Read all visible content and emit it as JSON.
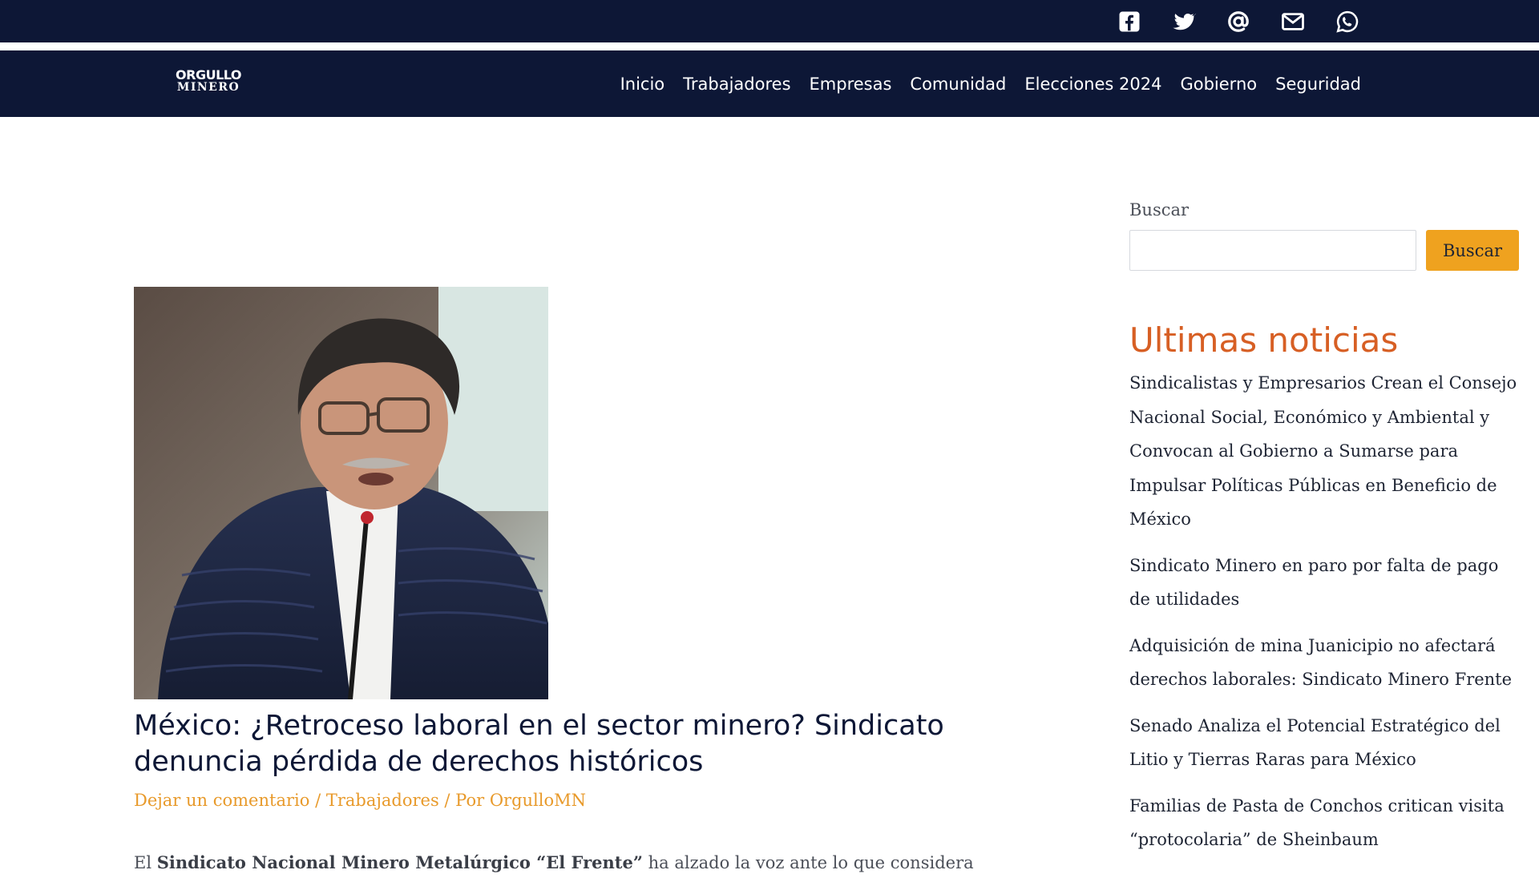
{
  "social": {
    "icons": [
      "facebook-icon",
      "twitter-icon",
      "at-sign-icon",
      "envelope-icon",
      "whatsapp-icon"
    ]
  },
  "header": {
    "logo_top": "ORGULLO",
    "logo_bottom": "MINERO",
    "nav": [
      "Inicio",
      "Trabajadores",
      "Empresas",
      "Comunidad",
      "Elecciones 2024",
      "Gobierno",
      "Seguridad"
    ]
  },
  "article": {
    "title": "México: ¿Retroceso laboral en el sector minero? Sindicato denuncia pérdida de derechos históricos",
    "meta": {
      "comment": "Dejar un comentario",
      "separator": "/",
      "category": "Trabajadores",
      "author_prefix": "Por",
      "author": "OrgulloMN"
    },
    "excerpt": {
      "lead": "El",
      "org": "Sindicato Nacional Minero Metalúrgico “El Frente”",
      "rest": "ha alzado la voz ante lo que considera"
    }
  },
  "sidebar": {
    "search_label": "Buscar",
    "search_value": "",
    "search_button": "Buscar",
    "news_heading": "Ultimas noticias",
    "news": [
      "Sindicalistas y Empresarios Crean el Consejo Nacional Social, Económico y Ambiental y Convocan al Gobierno a Sumarse para Impulsar Políticas Públicas en Beneficio de México",
      "Sindicato Minero en paro por falta de pago de utilidades",
      "Adquisición de mina Juanicipio no afectará derechos laborales: Sindicato Minero Frente",
      "Senado Analiza el Potencial Estratégico del Litio y Tierras Raras para México",
      "Familias de Pasta de Conchos critican visita “protocolaria” de Sheinbaum"
    ]
  },
  "colors": {
    "nav_bg": "#0d1736",
    "accent_orange": "#e89a2b",
    "button_orange": "#efa21f",
    "heading_orange": "#d75f24"
  }
}
